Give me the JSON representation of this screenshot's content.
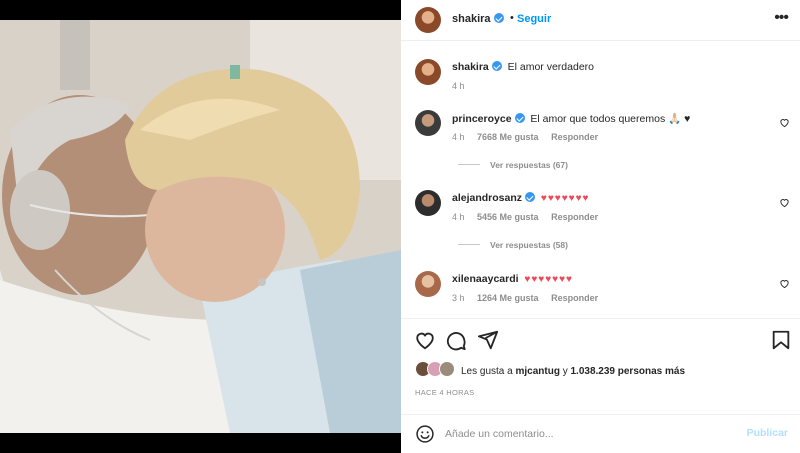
{
  "post": {
    "author": "shakira",
    "follow_label": "Seguir",
    "more_label": "•••",
    "separator": "•"
  },
  "caption": {
    "author": "shakira",
    "text": "El amor verdadero",
    "time": "4 h"
  },
  "comments": [
    {
      "author": "princeroyce",
      "text": "El amor que todos queremos 🙏🏻 ♥",
      "time": "4 h",
      "likes": "7668 Me gusta",
      "reply": "Responder",
      "view_replies": "Ver respuestas (67)"
    },
    {
      "author": "alejandrosanz",
      "text": "♥♥♥♥♥♥♥",
      "time": "4 h",
      "likes": "5456 Me gusta",
      "reply": "Responder",
      "view_replies": "Ver respuestas (58)"
    },
    {
      "author": "xilenaaycardi",
      "text": "♥♥♥♥♥♥♥",
      "time": "3 h",
      "likes": "1264 Me gusta",
      "reply": "Responder"
    }
  ],
  "likes": {
    "prefix": "Les gusta a ",
    "user": "mjcantug",
    "middle": " y ",
    "count": "1.038.239 personas más"
  },
  "posted_ago": "HACE 4 HORAS",
  "add_comment": {
    "placeholder": "Añade un comentario...",
    "publish_label": "Publicar"
  },
  "colors": {
    "accent": "#0095f6",
    "verified": "#3897f0",
    "heart": "#ed4956",
    "muted": "#8e8e8e",
    "publish_disabled": "#b2dffc"
  },
  "icons": [
    "verified-icon",
    "more-icon",
    "heart-icon",
    "comment-icon",
    "share-icon",
    "bookmark-icon",
    "emoji-icon"
  ]
}
